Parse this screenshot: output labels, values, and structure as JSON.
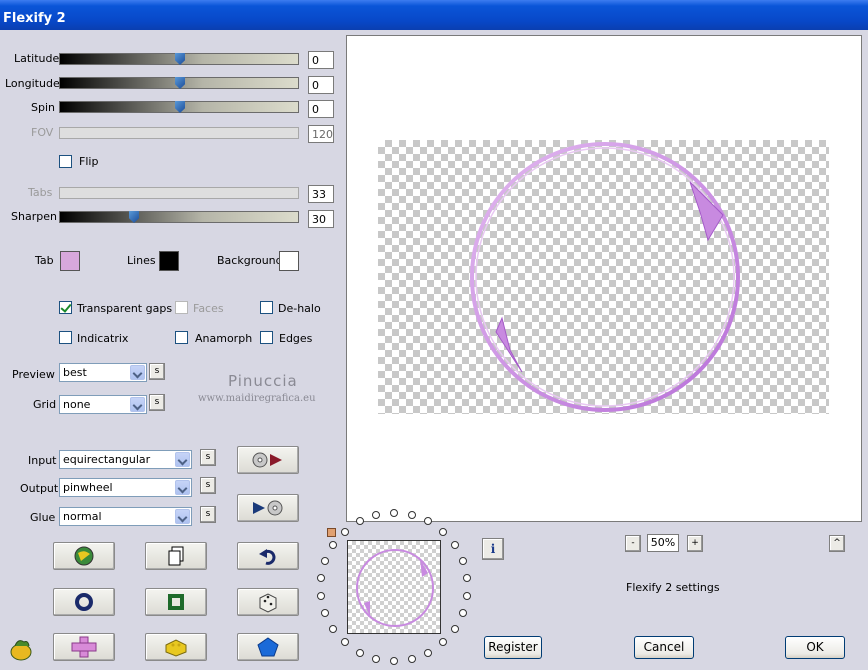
{
  "window": {
    "title": "Flexify 2"
  },
  "sliders": {
    "latitude": {
      "label": "Latitude",
      "value": "0",
      "fraction": 0.5
    },
    "longitude": {
      "label": "Longitude",
      "value": "0",
      "fraction": 0.5
    },
    "spin": {
      "label": "Spin",
      "value": "0",
      "fraction": 0.5
    },
    "fov": {
      "label": "FOV",
      "value": "120"
    },
    "tabs": {
      "label": "Tabs",
      "value": "33"
    },
    "sharpen": {
      "label": "Sharpen",
      "value": "30",
      "fraction": 0.3
    }
  },
  "flip": {
    "label": "Flip",
    "checked": false
  },
  "colors": {
    "tab": {
      "label": "Tab",
      "color": "#d8a8dc"
    },
    "lines": {
      "label": "Lines",
      "color": "#000000"
    },
    "background": {
      "label": "Background",
      "color": "#ffffff"
    }
  },
  "options": {
    "transparent_gaps": {
      "label": "Transparent gaps",
      "checked": true
    },
    "faces": {
      "label": "Faces",
      "checked": false,
      "enabled": false
    },
    "de_halo": {
      "label": "De-halo",
      "checked": false
    },
    "indicatrix": {
      "label": "Indicatrix",
      "checked": false
    },
    "anamorph": {
      "label": "Anamorph",
      "checked": false
    },
    "edges": {
      "label": "Edges",
      "checked": false
    }
  },
  "preview_select": {
    "label": "Preview",
    "value": "best"
  },
  "grid_select": {
    "label": "Grid",
    "value": "none"
  },
  "input_select": {
    "label": "Input",
    "value": "equirectangular"
  },
  "output_select": {
    "label": "Output",
    "value": "pinwheel"
  },
  "glue_select": {
    "label": "Glue",
    "value": "normal"
  },
  "small_button_label": "s",
  "watermark": {
    "name": "Pinuccia",
    "url": "www.maidiregrafica.eu"
  },
  "zoom": {
    "value": "50%",
    "minus": "-",
    "plus": "+"
  },
  "settings_label": "Flexify 2 settings",
  "info_label": "i",
  "collapse_label": "^",
  "buttons": {
    "register": "Register",
    "cancel": "Cancel",
    "ok": "OK"
  },
  "accent_colors": {
    "titlebar": "#0a55d8",
    "ring": "#c77ee0"
  }
}
